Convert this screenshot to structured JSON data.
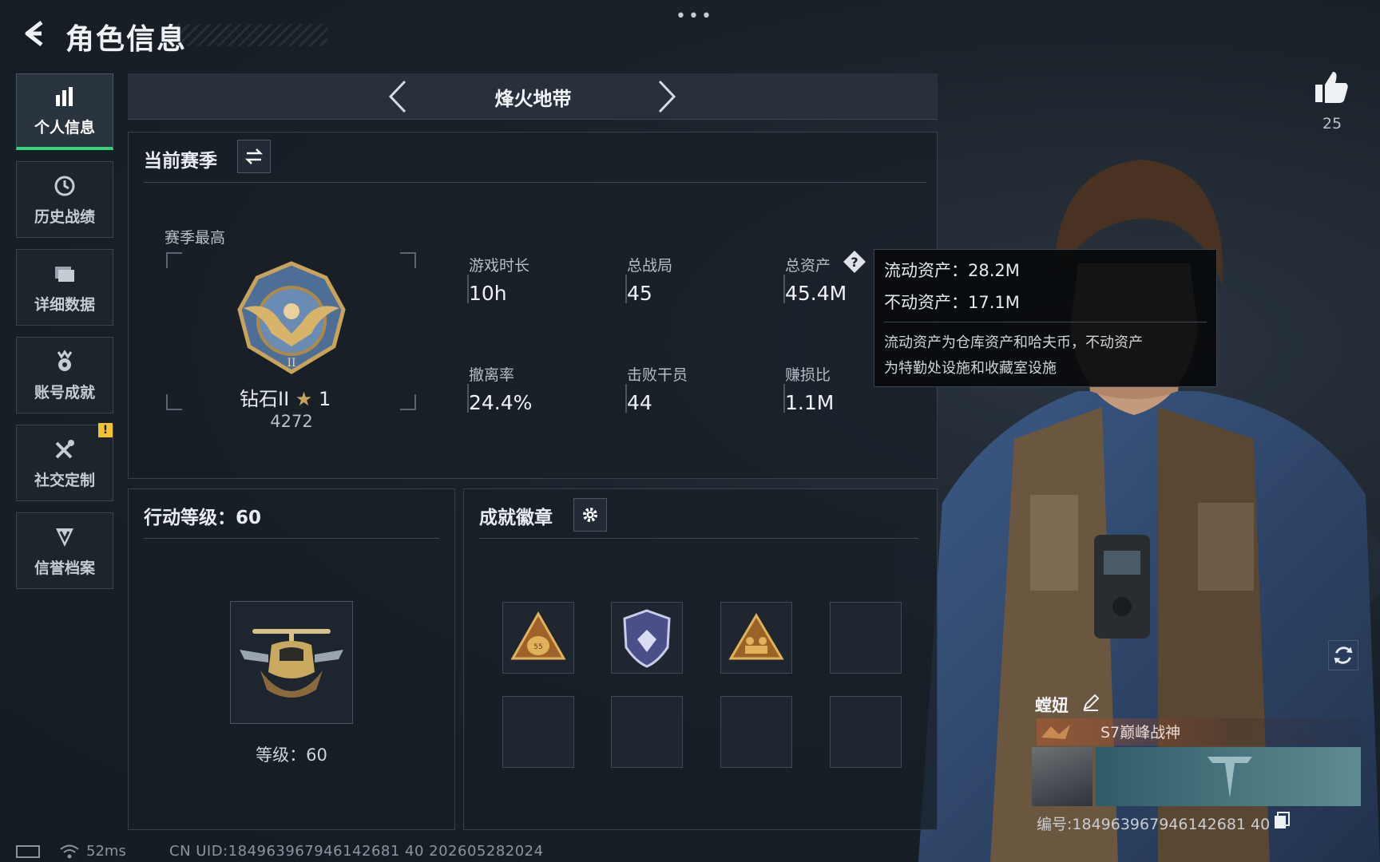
{
  "header": {
    "title": "角色信息",
    "menu_dots": "•••"
  },
  "sidebar": {
    "items": [
      {
        "label": "个人信息",
        "icon": "bar-chart-icon",
        "active": true
      },
      {
        "label": "历史战绩",
        "icon": "history-clock-icon",
        "active": false
      },
      {
        "label": "详细数据",
        "icon": "folder-icon",
        "active": false
      },
      {
        "label": "账号成就",
        "icon": "achievement-medal-icon",
        "active": false
      },
      {
        "label": "社交定制",
        "icon": "tools-icon",
        "active": false
      },
      {
        "label": "信誉档案",
        "icon": "shield-v-icon",
        "active": false
      }
    ],
    "warning_badge": "!"
  },
  "mode": {
    "title": "烽火地带"
  },
  "season": {
    "title": "当前赛季",
    "best_label": "赛季最高",
    "rank_name": "钻石II",
    "rank_stars": "1",
    "rank_score": "4272",
    "stats": [
      {
        "label": "游戏时长",
        "value": "10h"
      },
      {
        "label": "总战局",
        "value": "45"
      },
      {
        "label": "总资产",
        "value": "45.4M"
      },
      {
        "label": "撤离率",
        "value": "24.4%"
      },
      {
        "label": "击败干员",
        "value": "44"
      },
      {
        "label": "赚损比",
        "value": "1.1M"
      }
    ]
  },
  "tooltip": {
    "liquid": "流动资产：28.2M",
    "fixed": "不动资产：17.1M",
    "desc_1": "流动资产为仓库资产和哈夫币，不动资产",
    "desc_2": "为特勤处设施和收藏室设施"
  },
  "level": {
    "title": "行动等级：60",
    "label": "等级：60"
  },
  "badges": {
    "title": "成就徽章"
  },
  "profile": {
    "likes": "25",
    "player_name": "螳妞",
    "player_title": "S7巅峰战神",
    "player_id": "编号:184963967946142681 40"
  },
  "status": {
    "ping": "52ms",
    "uid": "CN UID:184963967946142681 40  202605282024"
  },
  "colors": {
    "accent_green": "#34d27a",
    "warning_yellow": "#f1c232"
  }
}
